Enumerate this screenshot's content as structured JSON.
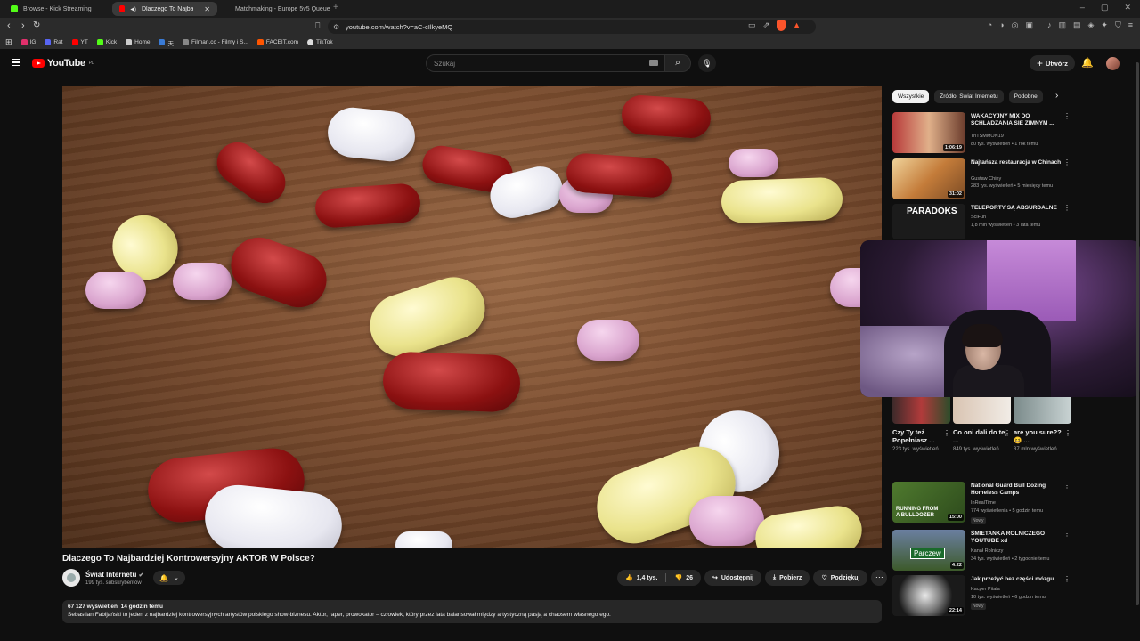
{
  "browser": {
    "tabs": [
      {
        "title": "Browse - Kick Streaming",
        "color": "#53fc18"
      },
      {
        "title": "Dlaczego To Najbardziej Kon",
        "color": "#ff0000"
      },
      {
        "title": "Matchmaking - Europe 5v5 Queue",
        "color": "#ff5500"
      }
    ],
    "url": "youtube.com/watch?v=aC-cIlkyeMQ",
    "bookmarks": [
      {
        "label": "IG",
        "color": "#e1306c"
      },
      {
        "label": "Rat",
        "color": "#5865f2"
      },
      {
        "label": "YT",
        "color": "#ff0000"
      },
      {
        "label": "Kick",
        "color": "#53fc18"
      },
      {
        "label": "Home",
        "color": "#cccccc"
      },
      {
        "label": "天",
        "color": "#3a7bd5"
      },
      {
        "label": "Filman.cc - Filmy i S...",
        "color": "#888888"
      },
      {
        "label": "FACEIT.com",
        "color": "#ff5500"
      },
      {
        "label": "TikTok",
        "color": "#dddddd"
      }
    ]
  },
  "header": {
    "logo": "YouTube",
    "logo_region": "PL",
    "search_placeholder": "Szukaj",
    "create_label": "Utwórz"
  },
  "video": {
    "title": "Dlaczego To Najbardziej Kontrowersyjny AKTOR W Polsce?",
    "channel": "Świat Internetu",
    "subscribers": "199 tys. subskrybentów",
    "likes": "1,4 tys.",
    "dislikes": "26",
    "share": "Udostępnij",
    "download": "Pobierz",
    "thanks": "Podziękuj",
    "views": "67 127 wyświetleń",
    "posted": "14 godzin temu",
    "description": "Sebastian Fabijański to jeden z najbardziej kontrowersyjnych artystów polskiego show-biznesu. Aktor, raper, prowokator – człowiek, który przez lata balansował między artystyczną pasją a chaosem własnego ego."
  },
  "chips": [
    "Wszystkie",
    "Źródło: Świat Internetu",
    "Podobne"
  ],
  "recommendations": [
    {
      "title": "WAKACYJNY MIX DO SCHLADZANIA SIĘ ZIMNYM ...",
      "channel": "TriTSMMON19",
      "meta": "80 tys. wyświetleń • 1 rok temu",
      "duration": "1:06:19",
      "badge": ""
    },
    {
      "title": "Najtańsza restauracja w Chinach",
      "channel": "Gustaw Chiny",
      "meta": "283 tys. wyświetleń • 5 miesięcy temu",
      "duration": "31:02",
      "badge": ""
    },
    {
      "title": "TELEPORTY SĄ ABSURDALNE",
      "channel": "SciFun",
      "meta": "1,8 mln wyświetleń • 3 lata temu",
      "duration": "",
      "badge": "",
      "thumb_text": "PARADOKS"
    },
    {
      "title": "National Guard Bull Dozing Homeless Camps",
      "channel": "InRealTime",
      "meta": "774 wyświetlenia • 5 godzin temu",
      "duration": "15:00",
      "badge": "Nowy",
      "thumb_text": "RUNNING FROM A BULLDOZER"
    },
    {
      "title": "ŚMIETANKA ROLNICZEGO YOUTUBE xd",
      "channel": "Kanał Rolniczy",
      "meta": "34 tys. wyświetleń • 2 tygodnie temu",
      "duration": "4:22",
      "badge": "",
      "thumb_text": "Parczew"
    },
    {
      "title": "Jak przeżyć bez części mózgu",
      "channel": "Kacper Pitala",
      "meta": "10 tys. wyświetleń • 6 godzin temu",
      "duration": "22:14",
      "badge": "Nowy"
    }
  ],
  "shorts": [
    {
      "title": "Czy Ty też Popełniasz ...",
      "views": "223 tys. wyświetleń"
    },
    {
      "title": "Co oni dali do tej ...",
      "views": "849 tys. wyświetleń"
    },
    {
      "title": "are you sure?? 😆 ...",
      "views": "37 mln wyświetleń"
    }
  ],
  "icons": {
    "menu": "menu-icon",
    "search": "search-icon",
    "mic": "mic-icon",
    "bell": "bell-icon",
    "like": "thumb-up-icon",
    "dislike": "thumb-down-icon",
    "share": "share-icon",
    "download": "download-icon",
    "thanks": "thanks-icon",
    "more": "more-icon"
  },
  "colors": {
    "brand": "#ff0000",
    "background": "#0f0f0f",
    "chip_active": "#f1f1f1"
  }
}
